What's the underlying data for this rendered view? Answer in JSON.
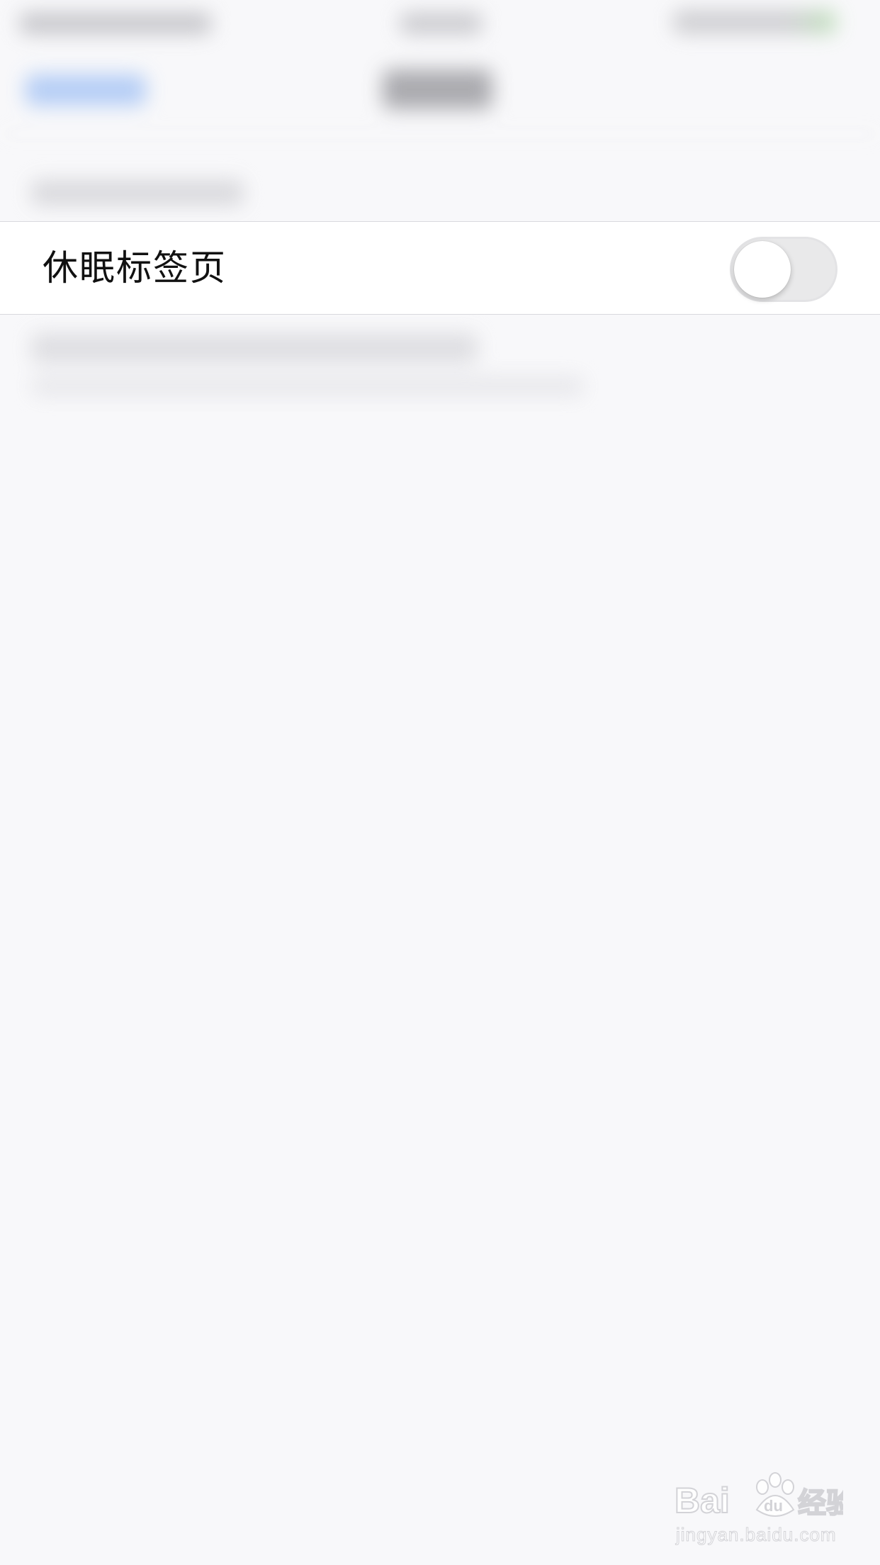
{
  "settings": {
    "row_label": "休眠标签页",
    "toggle_on": false
  },
  "watermark": {
    "site": "jingyan.baidu.com"
  },
  "colors": {
    "background": "#f8f8fa",
    "row_background": "#ffffff",
    "toggle_off_track": "#e9e9ea",
    "toggle_knob": "#ffffff",
    "blurred_link": "#a9c6f5"
  }
}
